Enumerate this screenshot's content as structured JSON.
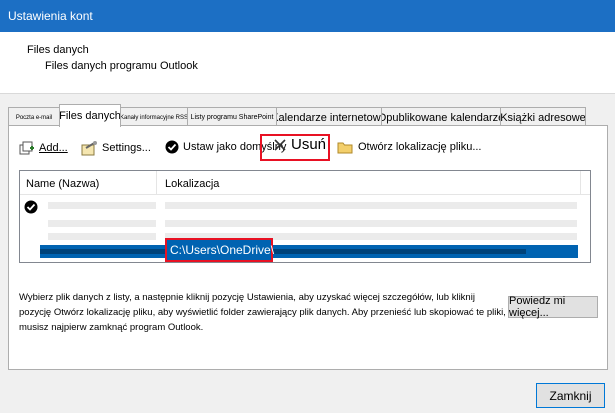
{
  "window": {
    "title": "Ustawienia kont"
  },
  "header": {
    "title": "Files danych",
    "subtitle": "Files danych programu Outlook"
  },
  "tabs": [
    {
      "label": "Poczta e-mail"
    },
    {
      "label": "Files danych"
    },
    {
      "label": "Kanały informacyjne RSS"
    },
    {
      "label": "Listy programu SharePoint"
    },
    {
      "label": "Kalendarze internetowe"
    },
    {
      "label": "Opublikowane kalendarze"
    },
    {
      "label": "Książki adresowe"
    }
  ],
  "toolbar": {
    "add_label": "Add...",
    "settings_label": "Settings...",
    "set_default_label": "Ustaw jako domyślny",
    "remove_label": "Usuń",
    "open_location_label": "Otwórz lokalizację pliku..."
  },
  "list": {
    "col_name": "Name (Nazwa)",
    "col_location": "Lokalizacja",
    "selected_location": "C:\\Users\\OneDrive\\"
  },
  "description": "Wybierz plik danych z listy, a następnie kliknij pozycję Ustawienia, aby uzyskać więcej szczegółów, lub kliknij pozycję Otwórz lokalizację pliku, aby wyświetlić folder zawierający plik danych. Aby przenieść lub skopiować te pliki, musisz najpierw zamknąć program Outlook.",
  "buttons": {
    "more_label": "Powiedz mi więcej...",
    "close_label": "Zamknij"
  },
  "colors": {
    "titlebar": "#1c6fc4",
    "selection": "#0063b1",
    "highlight": "#e81123"
  }
}
